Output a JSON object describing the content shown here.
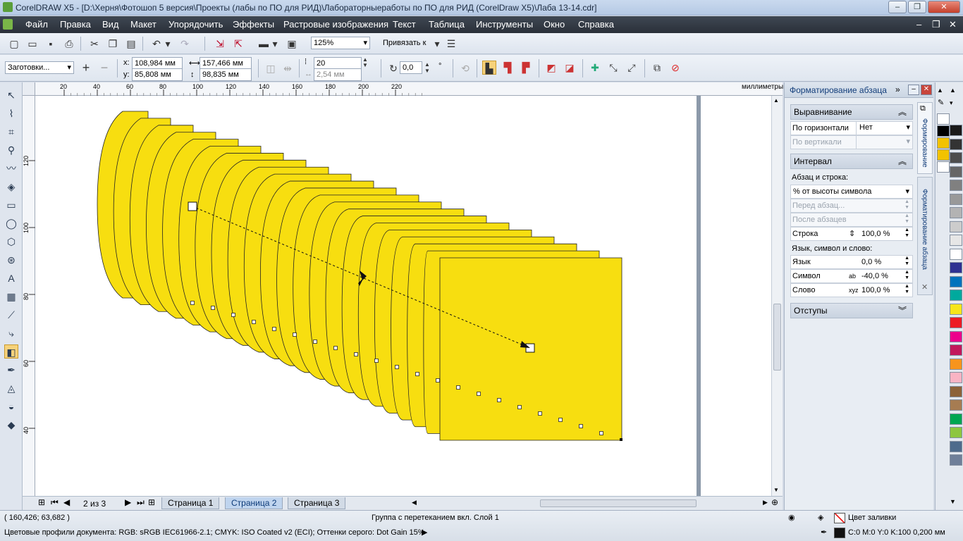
{
  "window": {
    "title": "CorelDRAW X5 - [D:\\Херня\\Фотошоп 5 версия\\Проекты (лабы по ПО для РИД)\\Лабораторныеработы по ПО для РИД (CorelDraw X5)\\Лаба 13-14.cdr]"
  },
  "menu": [
    "Файл",
    "Правка",
    "Вид",
    "Макет",
    "Упорядочить",
    "Эффекты",
    "Растровые изображения",
    "Текст",
    "Таблица",
    "Инструменты",
    "Окно",
    "Справка"
  ],
  "toolbar1": {
    "zoom": "125%",
    "snap": "Привязать к"
  },
  "toolbar2": {
    "presets": "Заготовки...",
    "x_label": "x:",
    "x": "108,984 мм",
    "y_label": "y:",
    "y": "85,808 мм",
    "width": "157,466 мм",
    "height": "98,835 мм",
    "steps": "20",
    "spacing": "2,54 мм",
    "angle": "0,0",
    "angle_unit": "°"
  },
  "ruler": {
    "unit": "миллиметры",
    "top_ticks": [
      "20",
      "40",
      "60",
      "80",
      "100",
      "120",
      "140",
      "160",
      "180",
      "200",
      "220"
    ],
    "left_ticks": [
      "120",
      "100",
      "80",
      "60",
      "40"
    ]
  },
  "pages": {
    "counter": "2 из 3",
    "tabs": [
      "Страница 1",
      "Страница 2",
      "Страница 3"
    ],
    "active": 1
  },
  "docker": {
    "title": "Форматирование абзаца",
    "align_header": "Выравнивание",
    "horiz_label": "По горизонтали",
    "horiz_value": "Нет",
    "vert_label": "По вертикали",
    "interval_header": "Интервал",
    "para_line_label": "Абзац и строка:",
    "para_line_value": "% от высоты символа",
    "before_label": "Перед абзац...",
    "after_label": "После абзацев",
    "line_label": "Строка",
    "line_value": "100,0 %",
    "lang_sym_label": "Язык, символ и слово:",
    "lang_label": "Язык",
    "lang_value": "0,0 %",
    "sym_label": "Символ",
    "sym_value": "-40,0 %",
    "word_label": "Слово",
    "word_value": "100,0 %",
    "indent_header": "Отступы",
    "tab1": "Формирование",
    "tab2": "Форматирование абзаца"
  },
  "palette": [
    "#ffffff",
    "#000000",
    "#f2c200",
    "#f2c200",
    "#ffffff",
    "#1a1a1a",
    "#333333",
    "#4d4d4d",
    "#666666",
    "#808080",
    "#999999",
    "#b3b3b3",
    "#cccccc",
    "#e6e6e6",
    "#ffffff",
    "#2e3192",
    "#0072bc",
    "#00a99d",
    "#f7e51a",
    "#ed1c24",
    "#ec008c",
    "#c2185b",
    "#f7941d",
    "#f9b4c4",
    "#8c6239",
    "#a67c52",
    "#00a651",
    "#8dc63f",
    "#4e6b8c",
    "#6f7f99"
  ],
  "status": {
    "coords": "( 160,426; 63,682 )",
    "info": "Группа с перетеканием вкл. Слой 1",
    "fill_label": "Цвет заливки",
    "profiles": "Цветовые профили документа: RGB: sRGB IEC61966-2.1; CMYK: ISO Coated v2 (ECI); Оттенки серого: Dot Gain 15%",
    "outline": "C:0 M:0 Y:0 K:100  0,200 мм"
  },
  "colors": {
    "blend_fill": "#f7de10"
  }
}
